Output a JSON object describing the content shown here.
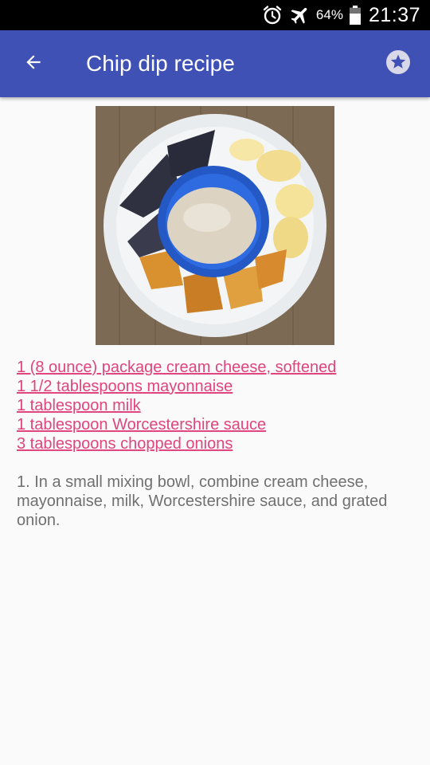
{
  "status_bar": {
    "battery": "64%",
    "time": "21:37",
    "icons": [
      "alarm-icon",
      "airplane-mode-icon",
      "battery-icon"
    ]
  },
  "toolbar": {
    "title": "Chip dip recipe",
    "back_icon": "arrow-back-icon",
    "favorite_icon": "star-icon",
    "color": "#3f51b5"
  },
  "recipe": {
    "image_subject": "chip-dip-photo",
    "ingredients": [
      "1 (8 ounce) package cream cheese, softened",
      "1 1/2 tablespoons mayonnaise",
      "1 tablespoon milk",
      "1 tablespoon Worcestershire sauce",
      "3 tablespoons chopped onions"
    ],
    "steps": [
      "1. In a small mixing bowl, combine cream cheese, mayonnaise, milk, Worcestershire sauce, and grated onion."
    ],
    "link_color": "#e0457b"
  }
}
